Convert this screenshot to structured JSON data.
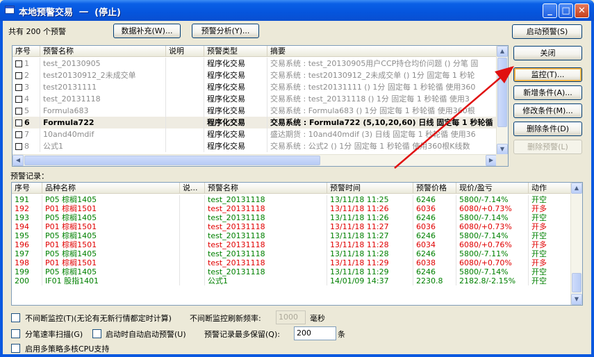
{
  "window": {
    "title": "本地预警交易  一  (停止)",
    "controls": {
      "minimize": "_",
      "maximize": "□",
      "close": "✕"
    }
  },
  "toolbar": {
    "total_text": "共有 200 个预警",
    "data_fill_button": "数据补充(W)...",
    "analysis_button": "预警分析(Y)...",
    "start_button": "启动预警(S)"
  },
  "side_buttons": {
    "close": "关闭",
    "monitor": "监控(T)...",
    "add": "新增条件(A)...",
    "modify": "修改条件(M)...",
    "delete_cond": "删除条件(D)",
    "delete_alert": "删除预警(L)"
  },
  "alert_table": {
    "columns": [
      "序号",
      "预警名称",
      "说明",
      "预警类型",
      "摘要"
    ],
    "rows": [
      {
        "no": "1",
        "name": "test_20130905",
        "desc": "",
        "type": "程序化交易",
        "summary": "交易系统 : test_20130905用户CCP持仓均价问题 () 分笔 固",
        "selected": false
      },
      {
        "no": "2",
        "name": "test20130912_2未成交单",
        "desc": "",
        "type": "程序化交易",
        "summary": "交易系统 : test20130912_2未成交单 () 1分 固定每 1 秒轮",
        "selected": false
      },
      {
        "no": "3",
        "name": "test20131111",
        "desc": "",
        "type": "程序化交易",
        "summary": "交易系统 : test20131111 () 1分 固定每 1 秒轮循 使用360",
        "selected": false
      },
      {
        "no": "4",
        "name": "test_20131118",
        "desc": "",
        "type": "程序化交易",
        "summary": "交易系统 : test_20131118 () 1分 固定每 1 秒轮循 使用3",
        "selected": false
      },
      {
        "no": "5",
        "name": "Formula683",
        "desc": "",
        "type": "程序化交易",
        "summary": "交易系统 : Formula683 () 1分 固定每 1 秒轮循 使用360根",
        "selected": false
      },
      {
        "no": "6",
        "name": "Formula722",
        "desc": "",
        "type": "程序化交易",
        "summary": "交易系统 : Formula722 (5,10,20,60) 日线 固定每 1 秒轮循",
        "selected": true
      },
      {
        "no": "7",
        "name": "10and40mdif",
        "desc": "",
        "type": "程序化交易",
        "summary": "盛达期货 : 10and40mdif (3) 日线 固定每 1 秒轮循 使用36",
        "selected": false
      },
      {
        "no": "8",
        "name": "公式1",
        "desc": "",
        "type": "程序化交易",
        "summary": "交易系统 : 公式2 () 1分 固定每 1 秒轮循 使用360根K线数",
        "selected": false
      }
    ]
  },
  "records": {
    "label": "预警记录：",
    "columns": [
      "序号",
      "品种名称",
      "说...",
      "预警名称",
      "预警时间",
      "预警价格",
      "现价/盈亏",
      "动作"
    ],
    "rows": [
      {
        "no": "191",
        "product": "P05 棕榈1405",
        "note": "",
        "name": "test_20131118",
        "time": "13/11/18 11:25",
        "price": "6246",
        "pnl": "5800/-7.14%",
        "action": "开空",
        "color": "green"
      },
      {
        "no": "192",
        "product": "P01 棕榈1501",
        "note": "",
        "name": "test_20131118",
        "time": "13/11/18 11:26",
        "price": "6036",
        "pnl": "6080/+0.73%",
        "action": "开多",
        "color": "red"
      },
      {
        "no": "193",
        "product": "P05 棕榈1405",
        "note": "",
        "name": "test_20131118",
        "time": "13/11/18 11:26",
        "price": "6246",
        "pnl": "5800/-7.14%",
        "action": "开空",
        "color": "green"
      },
      {
        "no": "194",
        "product": "P01 棕榈1501",
        "note": "",
        "name": "test_20131118",
        "time": "13/11/18 11:27",
        "price": "6036",
        "pnl": "6080/+0.73%",
        "action": "开多",
        "color": "red"
      },
      {
        "no": "195",
        "product": "P05 棕榈1405",
        "note": "",
        "name": "test_20131118",
        "time": "13/11/18 11:27",
        "price": "6246",
        "pnl": "5800/-7.14%",
        "action": "开空",
        "color": "green"
      },
      {
        "no": "196",
        "product": "P01 棕榈1501",
        "note": "",
        "name": "test_20131118",
        "time": "13/11/18 11:28",
        "price": "6034",
        "pnl": "6080/+0.76%",
        "action": "开多",
        "color": "red"
      },
      {
        "no": "197",
        "product": "P05 棕榈1405",
        "note": "",
        "name": "test_20131118",
        "time": "13/11/18 11:28",
        "price": "6246",
        "pnl": "5800/-7.11%",
        "action": "开空",
        "color": "green"
      },
      {
        "no": "198",
        "product": "P01 棕榈1501",
        "note": "",
        "name": "test_20131118",
        "time": "13/11/18 11:29",
        "price": "6038",
        "pnl": "6080/+0.70%",
        "action": "开多",
        "color": "red"
      },
      {
        "no": "199",
        "product": "P05 棕榈1405",
        "note": "",
        "name": "test_20131118",
        "time": "13/11/18 11:29",
        "price": "6246",
        "pnl": "5800/-7.14%",
        "action": "开空",
        "color": "green"
      },
      {
        "no": "200",
        "product": "IF01 股指1401",
        "note": "",
        "name": "公式1",
        "time": "14/01/09 14:37",
        "price": "2230.8",
        "pnl": "2182.8/-2.15%",
        "action": "开空",
        "color": "green"
      }
    ]
  },
  "options": {
    "continuous_monitor": "不间断监控(T)(无论有无新行情都定时计算)",
    "refresh_label": "不间断监控刷新频率:",
    "refresh_value": "1000",
    "refresh_unit": "毫秒",
    "tiered_scan": "分笔速率扫描(G)",
    "auto_start": "启动时自动启动预警(U)",
    "max_records_label": "预警记录最多保留(Q):",
    "max_records_value": "200",
    "max_records_unit": "条",
    "multi_core": "启用多策略多核CPU支持"
  },
  "colors": {
    "title_bar": "#0a5fe6",
    "buy_color": "#e00000",
    "sell_color": "#008000",
    "annotation_arrow": "#e01010"
  }
}
